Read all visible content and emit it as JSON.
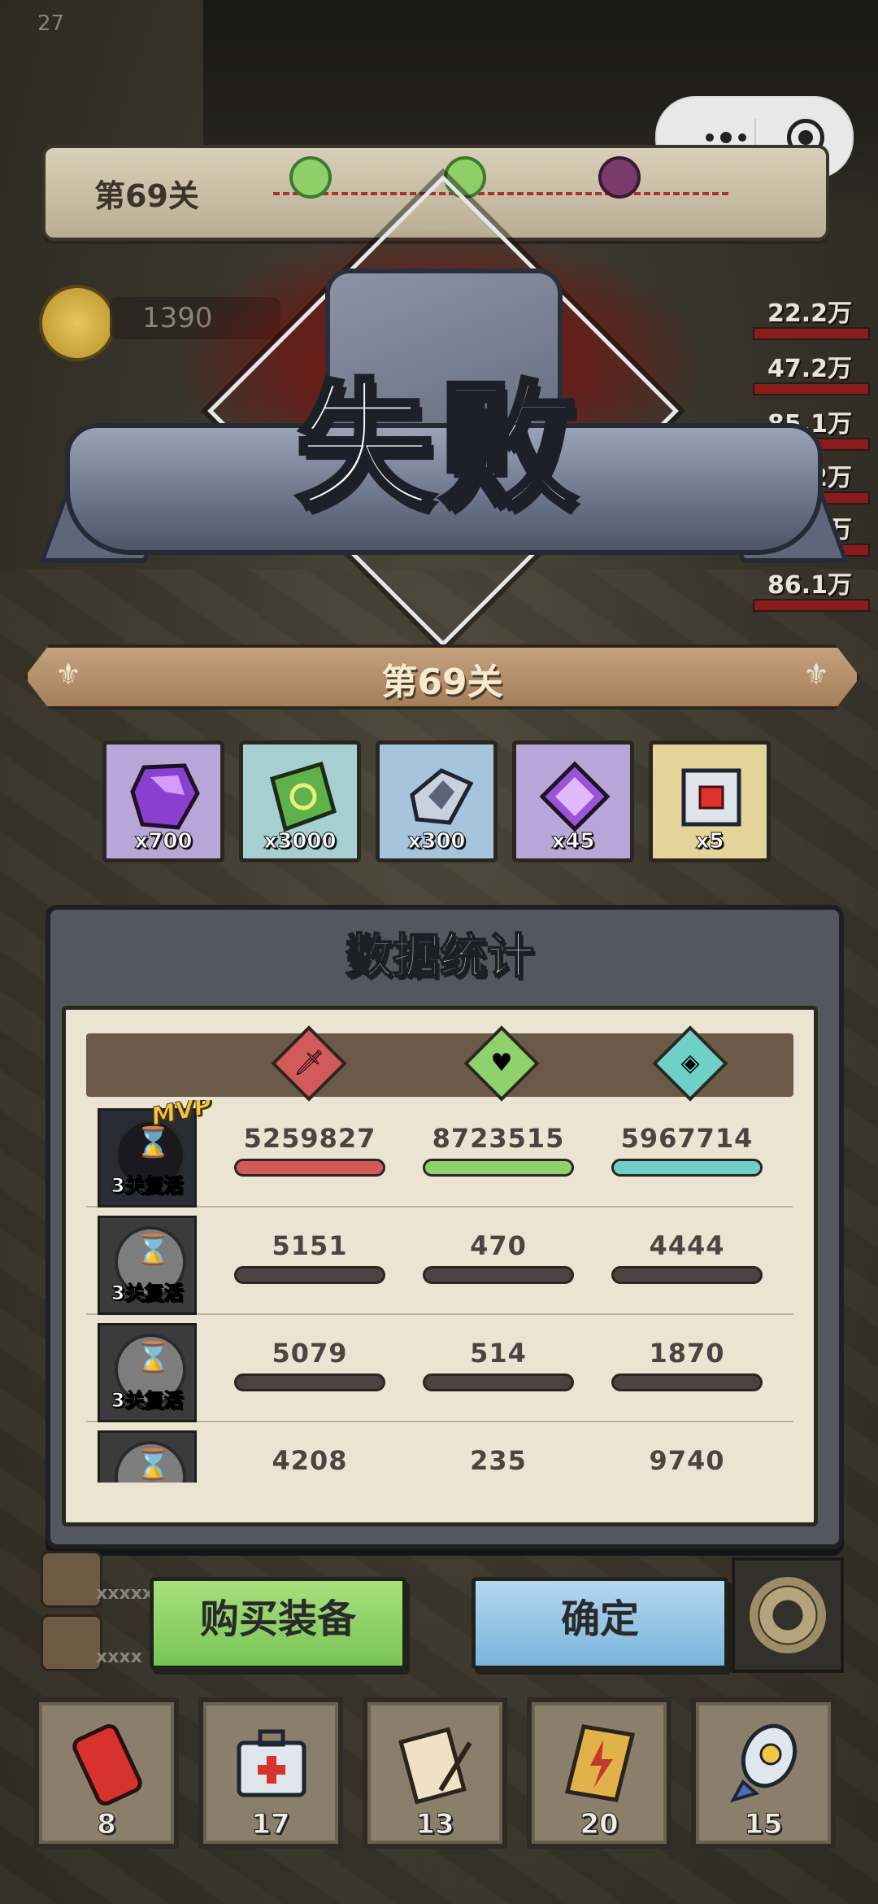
{
  "frame_counter": "27",
  "top_bar": {
    "stage_label": "第69关",
    "coin_value": "1390"
  },
  "dps_list": [
    "22.2万",
    "47.2万",
    "85.1万",
    "86.2万",
    "7.6万",
    "86.1万"
  ],
  "result": {
    "title": "失败",
    "level": "第69关"
  },
  "rewards": [
    {
      "icon": "purple-crystal",
      "count": "x700",
      "bg": "#b8a6d8"
    },
    {
      "icon": "green-ticket",
      "count": "x3000",
      "bg": "#a6d0d0"
    },
    {
      "icon": "diamond-shard",
      "count": "x300",
      "bg": "#a6c4dc"
    },
    {
      "icon": "purple-gem",
      "count": "x45",
      "bg": "#b8a6d8"
    },
    {
      "icon": "red-cube",
      "count": "x5",
      "bg": "#e4d49a"
    }
  ],
  "stats": {
    "title": "数据统计",
    "columns": [
      {
        "icon": "sword-icon",
        "color": "#d35a5a"
      },
      {
        "icon": "heal-heart-icon",
        "color": "#8fd16c"
      },
      {
        "icon": "shield-icon",
        "color": "#6fd0c8"
      }
    ],
    "rows": [
      {
        "mvp": "MVP",
        "revive": "3关复活",
        "values": [
          "5259827",
          "8723515",
          "5967714"
        ],
        "fill": [
          1,
          1,
          1
        ]
      },
      {
        "mvp": "",
        "revive": "3关复活",
        "values": [
          "5151",
          "470",
          "4444"
        ],
        "fill": [
          0,
          0,
          0
        ]
      },
      {
        "mvp": "",
        "revive": "3关复活",
        "values": [
          "5079",
          "514",
          "1870"
        ],
        "fill": [
          0,
          0,
          0
        ]
      },
      {
        "mvp": "",
        "revive": "",
        "values": [
          "4208",
          "235",
          "9740"
        ],
        "fill": [
          0,
          0,
          0
        ]
      }
    ]
  },
  "buttons": {
    "buy": "购买装备",
    "confirm": "确定"
  },
  "side_players": [
    "xxxxx",
    "xxxx"
  ],
  "items": [
    {
      "icon": "cola-can",
      "count": "8"
    },
    {
      "icon": "first-aid-kit",
      "count": "17"
    },
    {
      "icon": "scroll-feather",
      "count": "13"
    },
    {
      "icon": "lightning-paper",
      "count": "20"
    },
    {
      "icon": "nuclear-bomb",
      "count": "15"
    }
  ],
  "colors": {
    "bar_empty": "#4c4240",
    "panel": "#54575f",
    "paper": "#ece4d2"
  }
}
